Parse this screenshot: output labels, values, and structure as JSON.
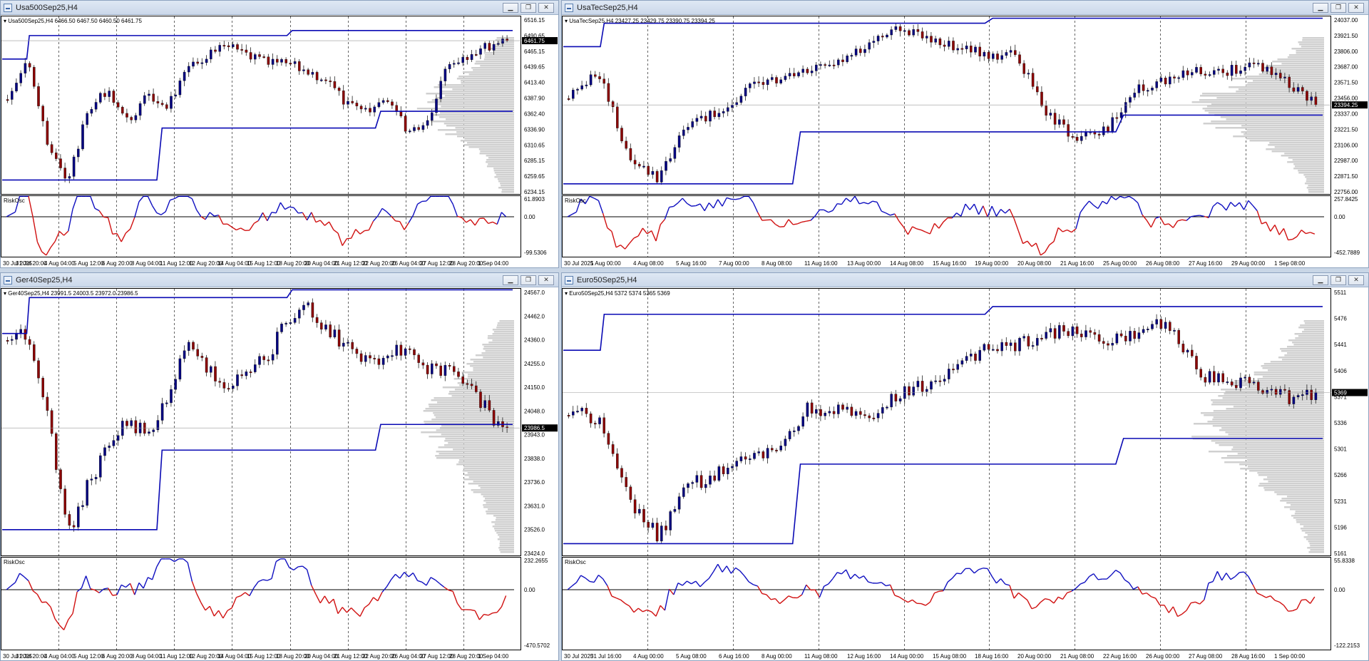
{
  "windows": [
    {
      "id": "w1",
      "title": "Usa500Sep25,H4",
      "quote": "Usa500Sep25,H4  6466.50 6467.50 6460.50 6461.75",
      "price_labels": [
        "6516.15",
        "6490.65",
        "6465.15",
        "6439.65",
        "6413.40",
        "6387.90",
        "6362.40",
        "6336.90",
        "6310.65",
        "6285.15",
        "6259.65",
        "6234.15"
      ],
      "current_price": "6461.75",
      "osc_name": "RiskOsc",
      "osc_labels": [
        "61.8903",
        "0.00",
        "-99.5306"
      ],
      "time_labels": [
        "30 Jul 2025",
        "31 Jul 20:00",
        "4 Aug 04:00",
        "5 Aug 12:00",
        "6 Aug 20:00",
        "8 Aug 04:00",
        "11 Aug 12:00",
        "12 Aug 20:00",
        "14 Aug 04:00",
        "15 Aug 12:00",
        "18 Aug 20:00",
        "20 Aug 04:00",
        "21 Aug 12:00",
        "22 Aug 20:00",
        "26 Aug 04:00",
        "27 Aug 12:00",
        "28 Aug 20:00",
        "1 Sep 04:00"
      ],
      "seed": 7,
      "shape": [
        0.45,
        0.2,
        0.75,
        0.95,
        0.55,
        0.4,
        0.6,
        0.45,
        0.5,
        0.3,
        0.2,
        0.15,
        0.2,
        0.25,
        0.25,
        0.3,
        0.35,
        0.5,
        0.55,
        0.45,
        0.65,
        0.6,
        0.25,
        0.2,
        0.15,
        0.1
      ]
    },
    {
      "id": "w2",
      "title": "UsaTecSep25,H4",
      "quote": "UsaTecSep25,H4  23427.25 23429.75 23390.75 23394.25",
      "price_labels": [
        "24037.00",
        "23921.50",
        "23806.00",
        "23687.00",
        "23571.50",
        "23456.00",
        "23337.00",
        "23221.50",
        "23106.00",
        "22987.00",
        "22871.50",
        "22756.00"
      ],
      "current_price": "23394.25",
      "osc_name": "RiskOsc",
      "osc_labels": [
        "257.8425",
        "0.00",
        "-452.7889"
      ],
      "time_labels": [
        "30 Jul 2025",
        "1 Aug 00:00",
        "4 Aug 08:00",
        "5 Aug 16:00",
        "7 Aug 00:00",
        "8 Aug 08:00",
        "11 Aug 16:00",
        "13 Aug 00:00",
        "14 Aug 08:00",
        "15 Aug 16:00",
        "19 Aug 00:00",
        "20 Aug 08:00",
        "21 Aug 16:00",
        "25 Aug 00:00",
        "26 Aug 08:00",
        "27 Aug 16:00",
        "29 Aug 00:00",
        "1 Sep 08:00"
      ],
      "seed": 13,
      "shape": [
        0.45,
        0.3,
        0.8,
        0.95,
        0.6,
        0.55,
        0.4,
        0.35,
        0.3,
        0.25,
        0.15,
        0.05,
        0.1,
        0.15,
        0.2,
        0.2,
        0.55,
        0.7,
        0.65,
        0.4,
        0.35,
        0.3,
        0.3,
        0.25,
        0.35,
        0.5
      ]
    },
    {
      "id": "w3",
      "title": "Ger40Sep25,H4",
      "quote": "Ger40Sep25,H4  23991.5 24003.5 23972.0 23986.5",
      "price_labels": [
        "24567.0",
        "24462.0",
        "24360.0",
        "24255.0",
        "24150.0",
        "24048.0",
        "23943.0",
        "23838.0",
        "23736.0",
        "23631.0",
        "23526.0",
        "23424.0"
      ],
      "current_price": "23986.5",
      "osc_name": "RiskOsc",
      "osc_labels": [
        "232.2655",
        "0.00",
        "-470.5702"
      ],
      "time_labels": [
        "30 Jul 2025",
        "31 Jul 20:00",
        "4 Aug 04:00",
        "5 Aug 12:00",
        "6 Aug 20:00",
        "8 Aug 04:00",
        "11 Aug 12:00",
        "12 Aug 20:00",
        "14 Aug 04:00",
        "15 Aug 12:00",
        "18 Aug 20:00",
        "20 Aug 04:00",
        "21 Aug 12:00",
        "22 Aug 20:00",
        "26 Aug 04:00",
        "27 Aug 12:00",
        "28 Aug 20:00",
        "1 Sep 04:00"
      ],
      "seed": 21,
      "shape": [
        0.2,
        0.15,
        0.45,
        0.95,
        0.75,
        0.6,
        0.5,
        0.55,
        0.4,
        0.2,
        0.3,
        0.35,
        0.3,
        0.25,
        0.1,
        0.05,
        0.15,
        0.2,
        0.25,
        0.25,
        0.2,
        0.3,
        0.3,
        0.35,
        0.45,
        0.55
      ]
    },
    {
      "id": "w4",
      "title": "Euro50Sep25,H4",
      "quote": "Euro50Sep25,H4  5372 5374 5365 5369",
      "price_labels": [
        "5511",
        "5476",
        "5441",
        "5406",
        "5371",
        "5336",
        "5301",
        "5266",
        "5231",
        "5196",
        "5161"
      ],
      "current_price": "5369",
      "osc_name": "RiskOsc",
      "osc_labels": [
        "55.8338",
        "0.00",
        "-122.2153"
      ],
      "time_labels": [
        "30 Jul 2025",
        "31 Jul 16:00",
        "4 Aug 00:00",
        "5 Aug 08:00",
        "6 Aug 16:00",
        "8 Aug 00:00",
        "11 Aug 08:00",
        "12 Aug 16:00",
        "14 Aug 00:00",
        "15 Aug 08:00",
        "18 Aug 16:00",
        "20 Aug 00:00",
        "21 Aug 08:00",
        "22 Aug 16:00",
        "26 Aug 00:00",
        "27 Aug 08:00",
        "28 Aug 16:00",
        "1 Sep 00:00"
      ],
      "seed": 33,
      "shape": [
        0.45,
        0.5,
        0.8,
        0.95,
        0.75,
        0.7,
        0.65,
        0.6,
        0.45,
        0.45,
        0.5,
        0.4,
        0.35,
        0.3,
        0.2,
        0.2,
        0.15,
        0.15,
        0.2,
        0.15,
        0.1,
        0.3,
        0.35,
        0.35,
        0.4,
        0.4
      ]
    }
  ],
  "colors": {
    "bull": "#000080",
    "bear": "#8b0000",
    "osc_pos": "#1010c0",
    "osc_neg": "#d01010",
    "level": "#0a0ab4",
    "profile": "#d0d0d0"
  }
}
